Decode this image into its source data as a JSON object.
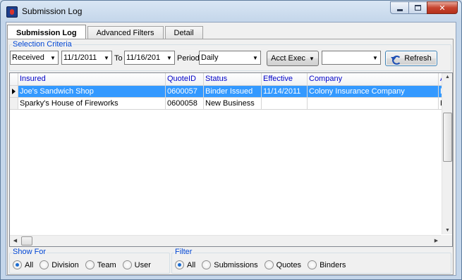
{
  "window": {
    "title": "Submission Log"
  },
  "tabs": [
    {
      "label": "Submission Log",
      "active": true
    },
    {
      "label": "Advanced Filters",
      "active": false
    },
    {
      "label": "Detail",
      "active": false
    }
  ],
  "criteria": {
    "group_label": "Selection Criteria",
    "date_type": "Received",
    "from_date": "11/1/2011",
    "to_label": "To",
    "to_date": "11/16/201",
    "period_label": "Period",
    "period": "Daily",
    "acct_exec_label": "Acct Exec",
    "acct_exec_value": "",
    "refresh_label": "Refresh"
  },
  "grid": {
    "columns": [
      "Insured",
      "QuoteID",
      "Status",
      "Effective",
      "Company",
      "A"
    ],
    "rows": [
      {
        "insured": "Joe's Sandwich Shop",
        "quote_id": "0600057",
        "status": "Binder Issued",
        "effective": "11/14/2011",
        "company": "Colony Insurance Company",
        "extra": "H",
        "selected": true
      },
      {
        "insured": "Sparky's House of Fireworks",
        "quote_id": "0600058",
        "status": "New Business",
        "effective": "",
        "company": "",
        "extra": "H",
        "selected": false
      }
    ]
  },
  "show_for": {
    "label": "Show For",
    "options": [
      "All",
      "Division",
      "Team",
      "User"
    ],
    "selected": "All"
  },
  "filter": {
    "label": "Filter",
    "options": [
      "All",
      "Submissions",
      "Quotes",
      "Binders"
    ],
    "selected": "All"
  }
}
